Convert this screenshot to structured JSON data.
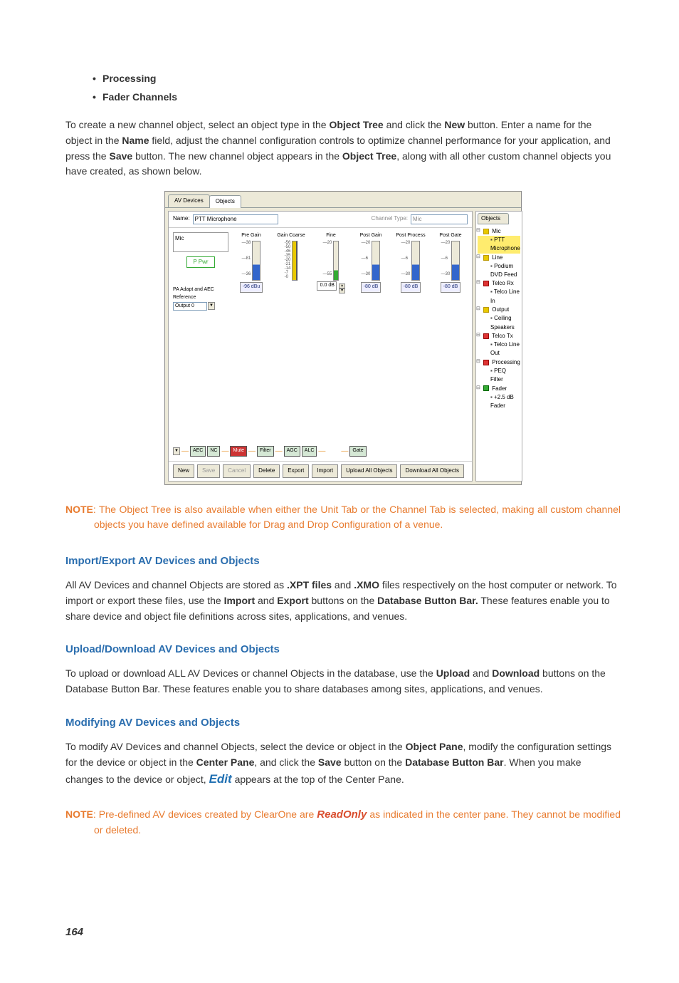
{
  "bullets": [
    "Processing",
    "Fader Channels"
  ],
  "intro": {
    "t1": "To create a new channel object, select an object type in the ",
    "b1": "Object Tree",
    "t2": " and click the ",
    "b2": "New",
    "t3": " button. Enter a name for the object in the ",
    "b3": "Name",
    "t4": " field, adjust the channel configuration controls to optimize channel performance for your application, and press the ",
    "b4": "Save",
    "t5": " button. The new channel object appears in the ",
    "b5": "Object Tree",
    "t6": ", along with all other custom channel objects you have created, as shown below."
  },
  "note1": {
    "label": "NOTE",
    "text": ": The Object Tree is also available when either the Unit Tab or the Channel Tab is selected, making all custom channel objects you have defined available for Drag and Drop Configuration of a venue."
  },
  "h1": "Import/Export AV Devices and Objects",
  "p1": {
    "t1": "All AV Devices and channel Objects are stored as ",
    "b1": ".XPT files",
    "t2": " and ",
    "b2": ".XMO",
    "t3": " files respectively on the host computer or network. To import or export these files, use the ",
    "b3": "Import",
    "t4": " and ",
    "b4": "Export",
    "t5": " buttons on the ",
    "b5": "Database Button Bar.",
    "t6": " These features enable you to share device and object file definitions across sites, applications, and venues."
  },
  "h2": "Upload/Download AV Devices and Objects",
  "p2": {
    "t1": "To upload or download ALL AV Devices or channel Objects in the database, use the ",
    "b1": "Upload",
    "t2": " and ",
    "b2": "Download",
    "t3": " buttons on the Database Button Bar. These features enable you to share databases among sites, applications, and venues."
  },
  "h3": "Modifying AV Devices and Objects",
  "p3": {
    "t1": "To modify AV Devices and channel Objects, select the device or object in the ",
    "b1": "Object Pane",
    "t2": ", modify the configuration settings for the device or object in the ",
    "b2": "Center Pane",
    "t3": ", and click the ",
    "b3": "Save",
    "t4": " button on the ",
    "b4": "Database Button Bar",
    "t5": ". When you make changes to the device or object, ",
    "edit": "Edit",
    "t6": " appears at the top of the Center Pane."
  },
  "note2": {
    "label": "NOTE",
    "t1": ": Pre-defined AV devices created by ClearOne are ",
    "ro": "ReadOnly",
    "t2": " as indicated in the center pane. They cannot be modified or deleted."
  },
  "pagenum": "164",
  "shot": {
    "tabs": [
      "AV Devices",
      "Objects"
    ],
    "nameLbl": "Name:",
    "nameVal": "PTT Microphone",
    "chTypeLbl": "Channel Type:",
    "chTypeVal": "Mic",
    "sideLbl": "Mic",
    "ppwr": "P Pwr",
    "paRef": "PA Adapt and AEC Reference",
    "paOut": "Output 0",
    "meters": {
      "preGain": {
        "label": "Pre Gain",
        "top": "—38",
        "mid": "—81",
        "bot": "—36",
        "btn": "-96 dBu"
      },
      "gainCoarse": {
        "label": "Gain Coarse",
        "ticks": [
          "-56",
          "-50",
          "-46",
          "-35",
          "-20",
          "-21",
          "-14",
          "-7",
          "-0"
        ]
      },
      "fine": {
        "label": "Fine",
        "top": "—20",
        "bot": "—55",
        "val": "0.0 dB"
      },
      "postGain": {
        "label": "Post Gain",
        "top": "—20",
        "mid": "—6",
        "bot": "—30",
        "btn": "-80 dB"
      },
      "postProc": {
        "label": "Post Process",
        "top": "—20",
        "mid": "—6",
        "bot": "—30",
        "btn": "-80 dB"
      },
      "postGate": {
        "label": "Post Gate",
        "top": "—20",
        "mid": "—6",
        "bot": "—30",
        "btn": "-80 dB"
      }
    },
    "chain": [
      "AEC",
      "NC",
      "Mute",
      "Filter",
      "AGC",
      "ALC",
      "Gate"
    ],
    "buttons": [
      "New",
      "Save",
      "Cancel",
      "Delete",
      "Export",
      "Import",
      "Upload All Objects",
      "Download All Objects"
    ],
    "tree": {
      "header": "Objects",
      "nodes": [
        {
          "label": "Mic",
          "color": "y",
          "children": [
            {
              "label": "PTT Microphone",
              "hl": true
            }
          ]
        },
        {
          "label": "Line",
          "color": "y",
          "children": [
            {
              "label": "Podium DVD Feed"
            }
          ]
        },
        {
          "label": "Telco Rx",
          "color": "r",
          "children": [
            {
              "label": "Telco Line In"
            }
          ]
        },
        {
          "label": "Output",
          "color": "y",
          "children": [
            {
              "label": "Ceiling Speakers"
            }
          ]
        },
        {
          "label": "Telco Tx",
          "color": "r",
          "children": [
            {
              "label": "Telco Line Out"
            }
          ]
        },
        {
          "label": "Processing",
          "color": "r",
          "children": [
            {
              "label": "PEQ Filter"
            }
          ]
        },
        {
          "label": "Fader",
          "color": "g",
          "children": [
            {
              "label": "+2.5 dB Fader"
            }
          ]
        }
      ]
    }
  }
}
